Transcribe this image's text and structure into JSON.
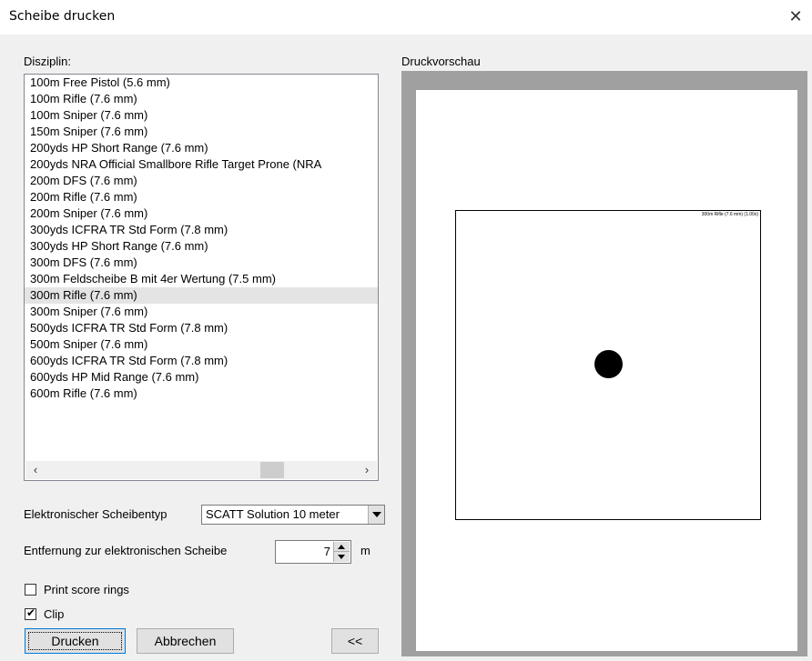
{
  "window": {
    "title": "Scheibe drucken",
    "close_glyph": "✕"
  },
  "discipline": {
    "label": "Disziplin:",
    "items": [
      "100m Free Pistol (5.6  mm)",
      "100m Rifle (7.6  mm)",
      "100m Sniper (7.6  mm)",
      "150m Sniper (7.6  mm)",
      "200yds HP Short Range (7.6  mm)",
      "200yds NRA Official Smallbore Rifle Target Prone (NRA",
      "200m DFS (7.6  mm)",
      "200m Rifle (7.6  mm)",
      "200m Sniper (7.6  mm)",
      "300yds ICFRA TR Std Form (7.8  mm)",
      "300yds HP Short Range (7.6  mm)",
      "300m DFS (7.6  mm)",
      "300m Feldscheibe B mit 4er Wertung (7.5  mm)",
      "300m Rifle (7.6  mm)",
      "300m Sniper (7.6  mm)",
      "500yds ICFRA TR Std Form (7.8  mm)",
      "500m Sniper (7.6  mm)",
      "600yds ICFRA TR Std Form (7.8  mm)",
      "600yds HP Mid Range (7.6  mm)",
      "600m Rifle (7.6  mm)"
    ],
    "selected_index": 13,
    "scroll_left": "‹",
    "scroll_right": "›"
  },
  "target_type": {
    "label": "Elektronischer Scheibentyp",
    "value": "SCATT Solution 10 meter"
  },
  "distance": {
    "label": "Entfernung zur elektronischen Scheibe",
    "value": "7",
    "unit": "m"
  },
  "options": {
    "print_score_rings": {
      "label": "Print score rings",
      "checked": false
    },
    "clip": {
      "label": "Clip",
      "checked": true
    }
  },
  "buttons": {
    "print": "Drucken",
    "cancel": "Abbrechen",
    "collapse": "<<"
  },
  "preview": {
    "label": "Druckvorschau",
    "target_caption": "300m Rifle (7.6  mm) (1.00x)"
  }
}
